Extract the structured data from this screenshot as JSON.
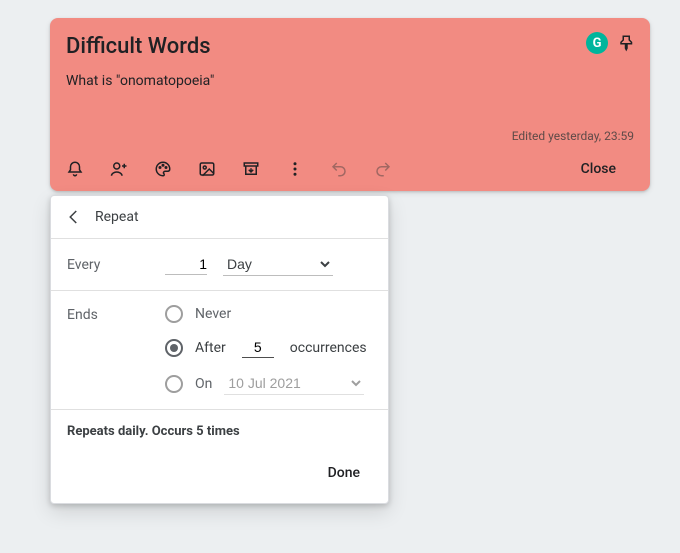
{
  "card": {
    "title": "Difficult Words",
    "body": "What is \"onomatopoeia\"",
    "edited": "Edited yesterday, 23:59",
    "badge": "G",
    "close": "Close"
  },
  "popover": {
    "title": "Repeat",
    "everyLabel": "Every",
    "everyValue": "1",
    "unit": "Day",
    "endsLabel": "Ends",
    "never": "Never",
    "afterPrefix": "After",
    "afterValue": "5",
    "afterSuffix": "occurrences",
    "onPrefix": "On",
    "onDate": "10 Jul 2021",
    "summary": "Repeats daily. Occurs 5 times",
    "done": "Done"
  }
}
